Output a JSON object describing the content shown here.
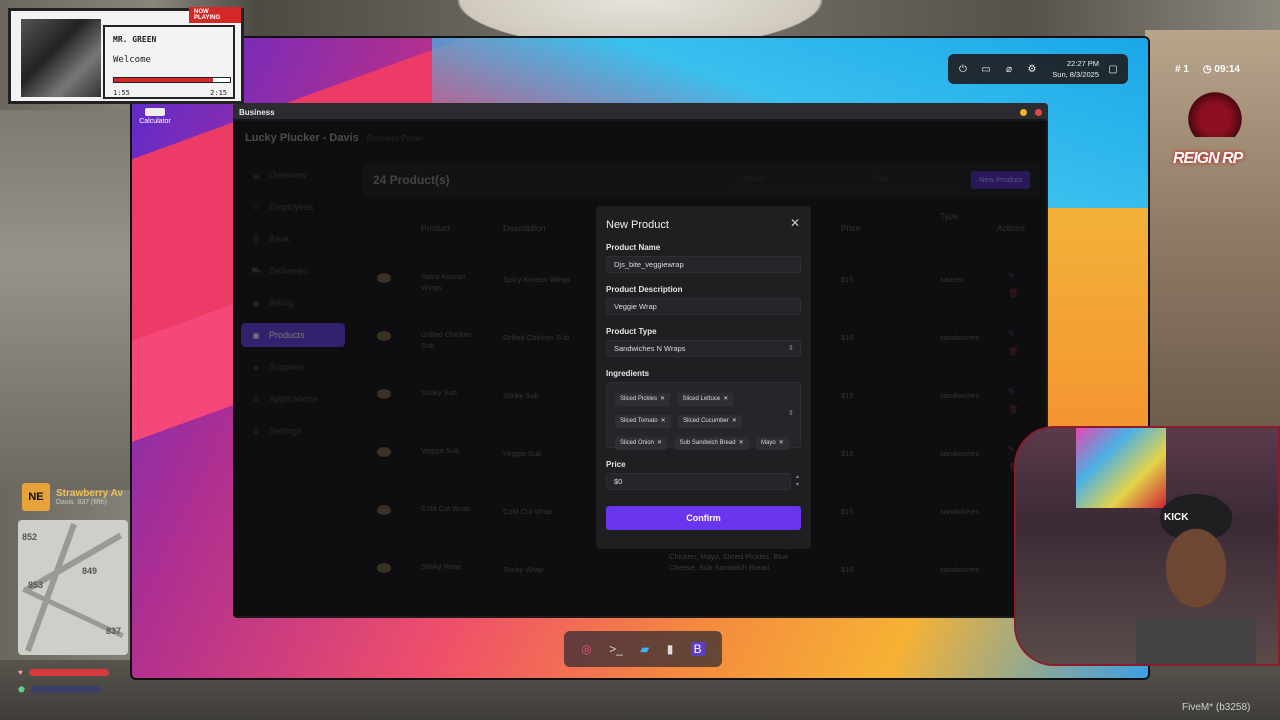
{
  "now_playing": {
    "tag": "NOW PLAYING",
    "artist": "MR. GREEN",
    "song": "Welcome",
    "elapsed": "1:55",
    "duration": "2:15",
    "progress": 0.85
  },
  "desktop": {
    "calculator_label": "Calculator",
    "tray": {
      "icons": [
        "power-icon",
        "battery-icon",
        "wifi-off-icon",
        "settings-icon"
      ],
      "time": "22:27 PM",
      "date": "Sun, 8/3/2025"
    }
  },
  "window": {
    "title": "Business",
    "business_name": "Lucky Plucker - Davis",
    "business_sub": "Business Panel",
    "sidebar": [
      {
        "label": "Overview",
        "icon": "▤"
      },
      {
        "label": "Employees",
        "icon": "☺"
      },
      {
        "label": "Bank",
        "icon": "▥"
      },
      {
        "label": "Deliveries",
        "icon": "⛟"
      },
      {
        "label": "Billing",
        "icon": "▦"
      },
      {
        "label": "Products",
        "icon": "▣",
        "active": true
      },
      {
        "label": "Supplies",
        "icon": "◈"
      },
      {
        "label": "Applications",
        "icon": "✉"
      },
      {
        "label": "Settings",
        "icon": "⚙"
      }
    ],
    "panel": {
      "title": "24 Product(s)",
      "search_placeholder": "Search",
      "filter_placeholder": "Filter",
      "new_product_label": "New Product"
    },
    "table": {
      "headers": {
        "product": "Product",
        "description": "Description",
        "price": "Price",
        "type": "Type",
        "actions": "Actions"
      },
      "rows": [
        {
          "name": "Spicy Korean Wings",
          "description": "Spicy Korean Wings",
          "price": "$15",
          "type": "sauces"
        },
        {
          "name": "Grilled Chicken Sub",
          "description": "Grilled Chicken Sub",
          "price": "$15",
          "type": "sandwiches"
        },
        {
          "name": "Stinky Sub",
          "description": "Stinky Sub",
          "price": "$15",
          "type": "sandwiches"
        },
        {
          "name": "Veggie Sub",
          "description": "Veggie Sub",
          "price": "$15",
          "type": "sandwiches"
        },
        {
          "name": "Cold Cut Wrap",
          "description": "Cold Cut Wrap",
          "price": "$15",
          "type": "sandwiches"
        },
        {
          "name": "Stinky Wrap",
          "description": "Stinky Wrap",
          "price": "$15",
          "type": "sandwiches"
        }
      ],
      "last_ingredients": "Sliced Lettuce, Sliced Tomato, Chopped Chicken, Mayo, Sliced Pickles, Blue Cheese, Sub Sandwich Bread"
    }
  },
  "modal": {
    "title": "New Product",
    "product_name_label": "Product Name",
    "product_name_value": "Djs_bite_veggiewrap",
    "description_label": "Product Description",
    "description_value": "Veggie Wrap",
    "type_label": "Product Type",
    "type_value": "Sandwiches N Wraps",
    "ingredients_label": "Ingredients",
    "ingredients": [
      "Sliced Pickles",
      "Sliced Lettuce",
      "Sliced Tomato",
      "Sliced Cucumber",
      "Sliced Onion",
      "Sub Sandwich Bread",
      "Mayo"
    ],
    "price_label": "Price",
    "price_value": "$0",
    "confirm_label": "Confirm"
  },
  "hud": {
    "players": "1",
    "clock": "09:14",
    "logo_text": "REIGN RP",
    "street_code": "NE",
    "street_name": "Strawberry Av",
    "street_sub": "Davis, 837 (fifth)",
    "map_numbers": [
      "852",
      "849",
      "853",
      "837"
    ],
    "hat_text": "KICK",
    "footer": "FiveM* (b3258)"
  },
  "colors": {
    "accent": "#6a35ee",
    "sidebar_active": "#5c3fc7",
    "np_red": "#d42828"
  }
}
